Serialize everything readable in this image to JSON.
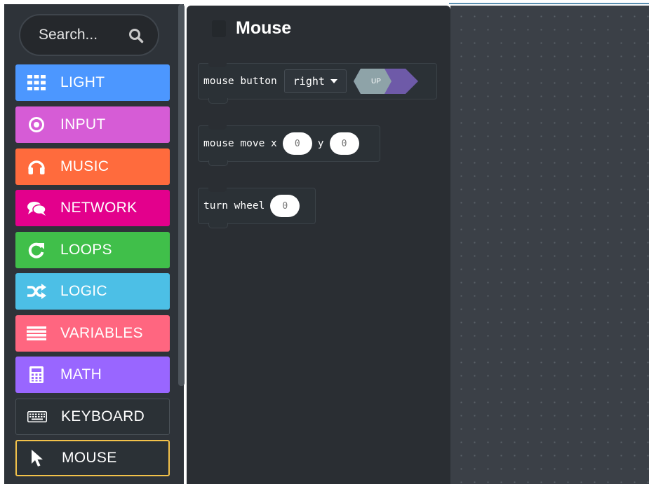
{
  "search": {
    "placeholder": "Search..."
  },
  "categories": [
    {
      "label": "LIGHT",
      "icon": "grid-icon",
      "color": "#4c97ff"
    },
    {
      "label": "INPUT",
      "icon": "target-icon",
      "color": "#d65cd6"
    },
    {
      "label": "MUSIC",
      "icon": "headphones-icon",
      "color": "#ff6b3d"
    },
    {
      "label": "NETWORK",
      "icon": "chat-icon",
      "color": "#e3008c"
    },
    {
      "label": "LOOPS",
      "icon": "refresh-icon",
      "color": "#40bf4a"
    },
    {
      "label": "LOGIC",
      "icon": "shuffle-icon",
      "color": "#4cbfe6"
    },
    {
      "label": "VARIABLES",
      "icon": "list-icon",
      "color": "#ff6680"
    },
    {
      "label": "MATH",
      "icon": "calculator-icon",
      "color": "#9966ff"
    },
    {
      "label": "KEYBOARD",
      "icon": "keyboard-icon",
      "color": "#2b3136"
    },
    {
      "label": "MOUSE",
      "icon": "cursor-icon",
      "color": "#2b3136",
      "selected": true
    }
  ],
  "flyout": {
    "title": "Mouse",
    "blocks": {
      "mouse_button": {
        "text": "mouse button",
        "dropdown": "right",
        "state": "UP"
      },
      "mouse_move": {
        "text": "mouse move x",
        "x": "0",
        "ylabel": "y",
        "y": "0"
      },
      "turn_wheel": {
        "text": "turn wheel",
        "value": "0"
      }
    }
  }
}
